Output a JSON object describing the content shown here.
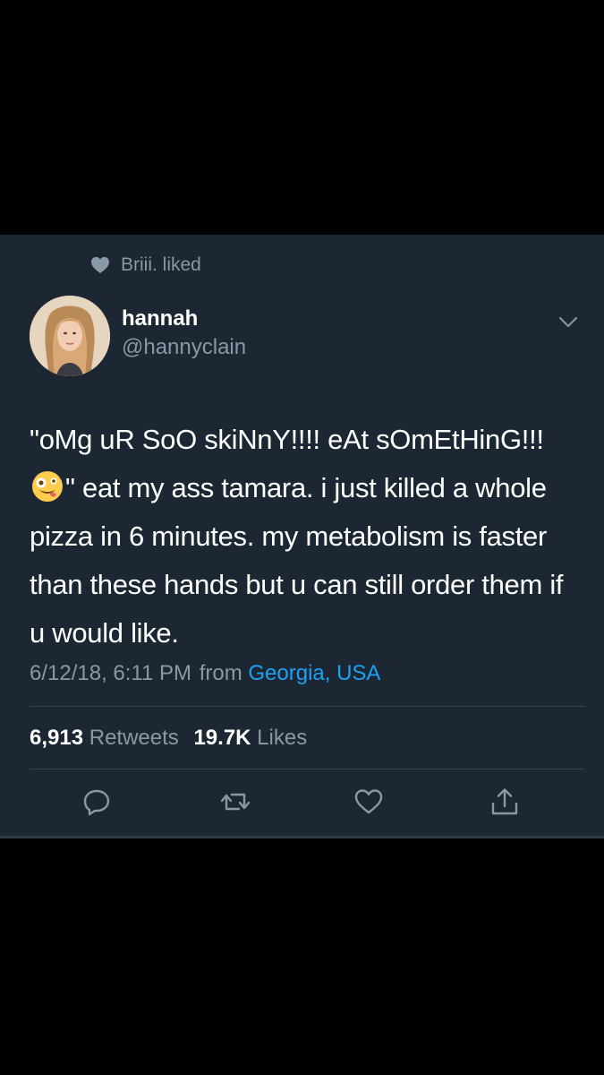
{
  "social_context": {
    "icon": "heart-icon",
    "text": "Briii. liked"
  },
  "author": {
    "name": "hannah",
    "handle": "@hannyclain",
    "avatar_icon": "avatar"
  },
  "tweet": {
    "text_part1": "\"oMg uR SoO skiNnY!!!! eAt sOmEtHinG!!!",
    "emoji": "zany-face-emoji",
    "text_part2": "\" eat my ass tamara. i just killed a whole pizza in 6 minutes. my metabolism is faster than these hands but u can still order them if u would like.",
    "timestamp": "6/12/18, 6:11 PM",
    "from_label": "from",
    "location": "Georgia, USA"
  },
  "stats": {
    "retweets_count": "6,913",
    "retweets_label": "Retweets",
    "likes_count": "19.7K",
    "likes_label": "Likes"
  },
  "actions": {
    "reply_icon": "reply-icon",
    "retweet_icon": "retweet-icon",
    "like_icon": "like-icon",
    "share_icon": "share-icon"
  },
  "colors": {
    "background": "#000000",
    "card": "#1c2733",
    "primary_text": "#ffffff",
    "secondary_text": "#8899a6",
    "link": "#1da1f2",
    "divider": "#38444d"
  }
}
